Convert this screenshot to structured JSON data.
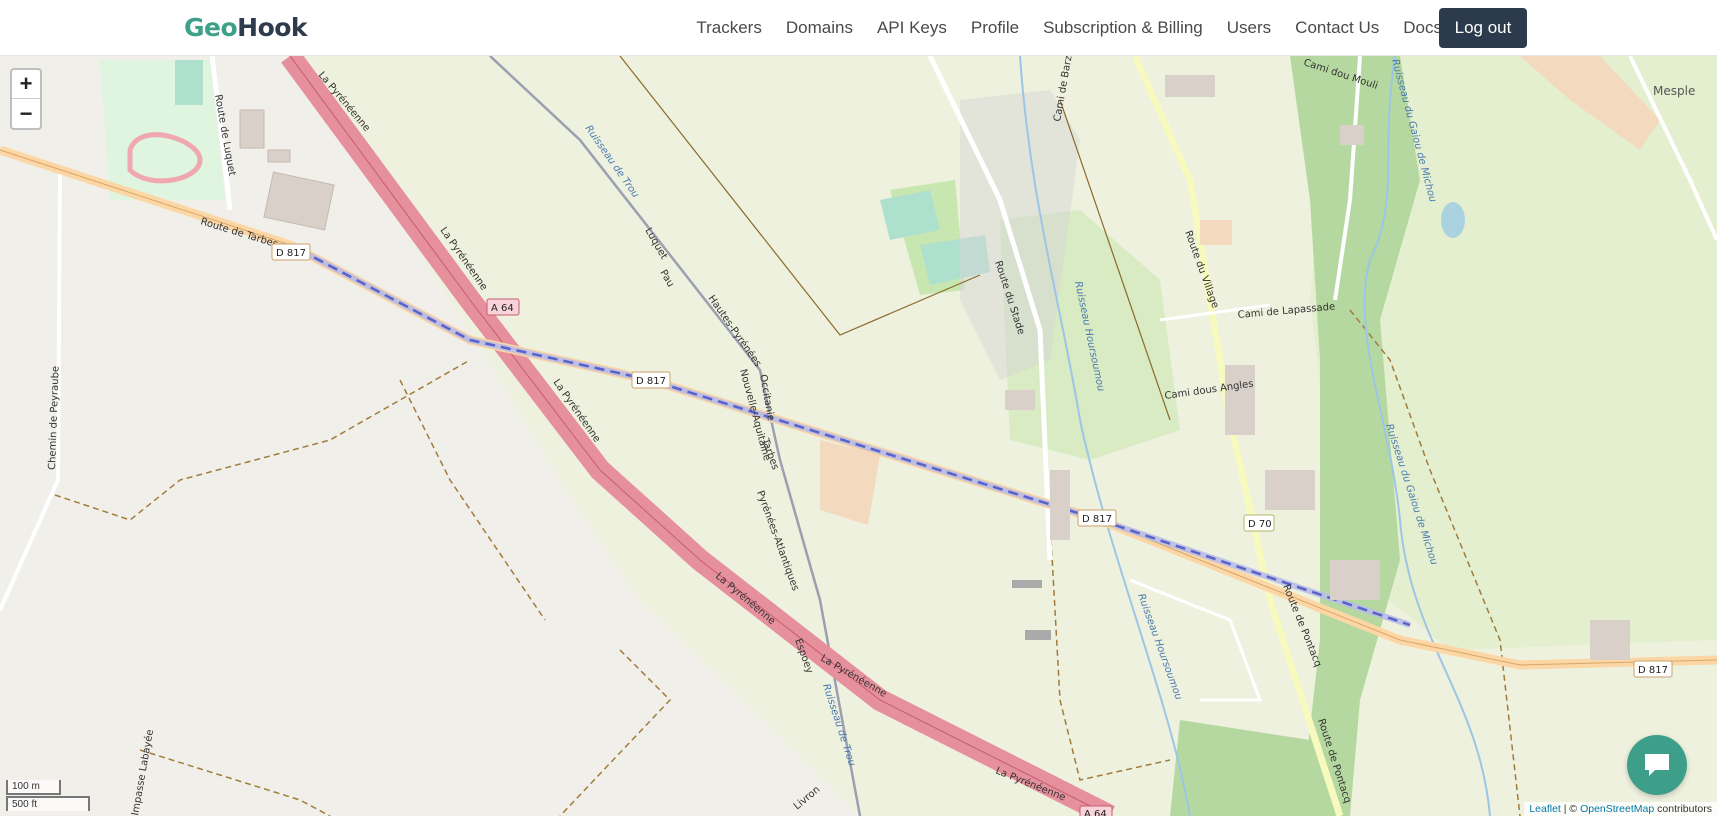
{
  "navbar": {
    "logo_part1": "Geo",
    "logo_part2": "Hook",
    "links": [
      "Trackers",
      "Domains",
      "API Keys",
      "Profile",
      "Subscription & Billing",
      "Users",
      "Contact Us",
      "Docs"
    ],
    "logout_label": "Log out"
  },
  "map": {
    "zoom_in": "+",
    "zoom_out": "−",
    "scale_metric": "100 m",
    "scale_imperial": "500 ft",
    "attribution_leaflet": "Leaflet",
    "attribution_sep": " | © ",
    "attribution_osm": "OpenStreetMap",
    "attribution_tail": " contributors",
    "labels": {
      "route_tarbes": "Route de Tarbes",
      "d817": "D 817",
      "a64": "A 64",
      "la_pyreneenne": "La Pyrénéenne",
      "route_luquet": "Route de Luquet",
      "chemin_peyraube": "Chemin de Peyraube",
      "ruisseau_trou": "Ruisseau de Trou",
      "luquet": "Luquet",
      "pau": "Pau",
      "hautes_pyrenees": "Hautes-Pyrénées",
      "nouvelle_aquitaine": "Nouvelle-Aquitaine",
      "occitanie": "Occitanie",
      "tarbes": "Tarbes",
      "pyrenees_atlantiques": "Pyrénées-Atlantiques",
      "espoey": "Espoey",
      "route_stade": "Route du Stade",
      "ruisseau_hoursoumou": "Ruisseau Hoursoumou",
      "cami_barzu": "Cami de Barzu",
      "route_village": "Route du Village",
      "cami_lapassade": "Cami de Lapassade",
      "cami_angles": "Cami dous Angles",
      "d70": "D 70",
      "route_pontacq": "Route de Pontacq",
      "cami_mouli": "Cami dou Mouli",
      "ruisseau_gaiou": "Ruisseau du Gaiou de Michou",
      "mesple": "Mesple",
      "livron": "Livron",
      "impasse": "Impasse Labayée"
    }
  },
  "chat": {
    "icon": "chat-bubble-icon"
  }
}
